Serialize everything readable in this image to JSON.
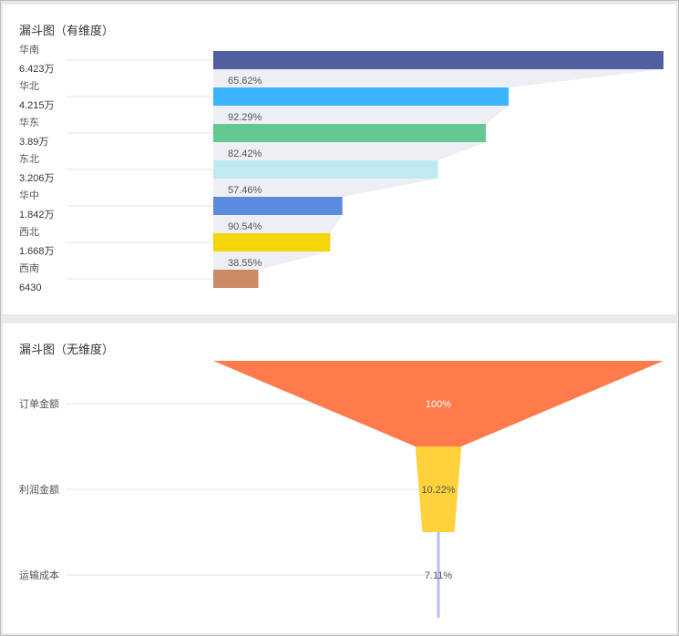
{
  "panel1": {
    "title": "漏斗图（有维度）"
  },
  "panel2": {
    "title": "漏斗图（无维度）"
  },
  "chart_data": [
    {
      "type": "bar",
      "subtype": "funnel-with-dimension",
      "title": "漏斗图（有维度）",
      "categories": [
        "华南",
        "华北",
        "华东",
        "东北",
        "华中",
        "西北",
        "西南"
      ],
      "values": [
        64230,
        42150,
        38900,
        32060,
        18420,
        16680,
        6430
      ],
      "value_labels": [
        "6.423万",
        "4.215万",
        "3.89万",
        "3.206万",
        "1.842万",
        "1.668万",
        "6430"
      ],
      "conversion_labels": [
        "65.62%",
        "92.29%",
        "82.42%",
        "57.46%",
        "90.54%",
        "38.55%"
      ],
      "colors": [
        "#4f5f9f",
        "#3ab4fb",
        "#65c892",
        "#bfeaf2",
        "#5b8be0",
        "#f4d40a",
        "#cc8966"
      ],
      "xlim": [
        0,
        64230
      ]
    },
    {
      "type": "bar",
      "subtype": "funnel-no-dimension",
      "title": "漏斗图（无维度）",
      "categories": [
        "订单金额",
        "利润金额",
        "运输成本"
      ],
      "values": [
        100,
        10.22,
        7.11
      ],
      "value_labels": [
        "100%",
        "10.22%",
        "7.11%"
      ],
      "colors": [
        "#ff7b4c",
        "#ffd23c",
        "#b7bcf7"
      ]
    }
  ]
}
